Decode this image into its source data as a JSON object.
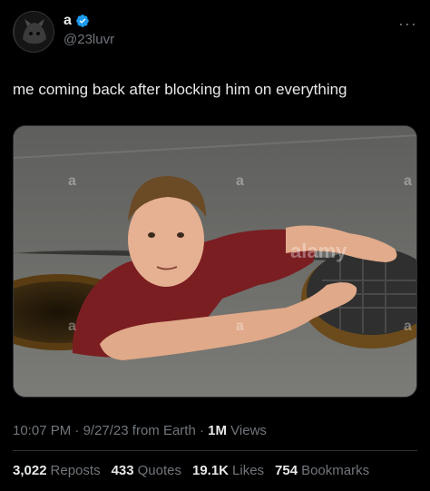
{
  "author": {
    "display_name": "a",
    "handle": "@23luvr",
    "verified": true
  },
  "tweet": {
    "text": "me coming back after blocking him on everything",
    "media_alt": "Man climbing out of a manhole onto asphalt street",
    "watermarks": [
      "a",
      "a",
      "a",
      "alamy",
      "a",
      "a",
      "a"
    ]
  },
  "meta": {
    "time": "10:07 PM",
    "date": "9/27/23",
    "source": "from Earth",
    "views_count": "1M",
    "views_label": "Views"
  },
  "stats": {
    "reposts_count": "3,022",
    "reposts_label": "Reposts",
    "quotes_count": "433",
    "quotes_label": "Quotes",
    "likes_count": "19.1K",
    "likes_label": "Likes",
    "bookmarks_count": "754",
    "bookmarks_label": "Bookmarks"
  },
  "colors": {
    "background": "#000000",
    "text": "#e7e9ea",
    "muted": "#71767b",
    "verified": "#1d9bf0"
  },
  "icons": {
    "more": "more-icon",
    "verified": "verified-badge-icon"
  }
}
